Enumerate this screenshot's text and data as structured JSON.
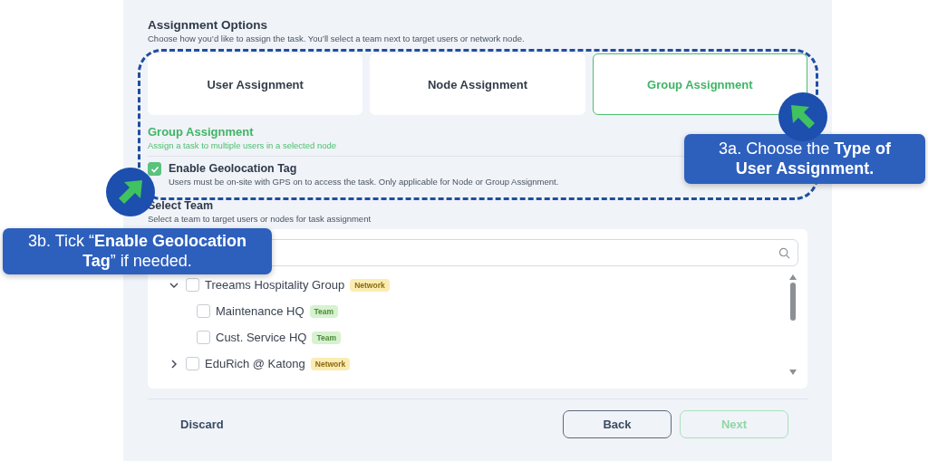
{
  "section": {
    "title": "Assignment Options",
    "subtitle": "Choose how you’d like to assign the task. You’ll select a team next to target users or network node."
  },
  "options": [
    {
      "label": "User Assignment",
      "selected": false
    },
    {
      "label": "Node Assignment",
      "selected": false
    },
    {
      "label": "Group Assignment",
      "selected": true
    }
  ],
  "selected_info": {
    "title": "Group Assignment",
    "subtitle": "Assign a task to multiple users in a selected node"
  },
  "geolocation": {
    "label": "Enable Geolocation Tag",
    "description": "Users must be on-site with GPS on to access the task. Only applicable for Node or Group Assignment.",
    "checked": true
  },
  "team": {
    "title": "Select Team",
    "subtitle": "Select a team to target users or nodes for task assignment"
  },
  "tree": [
    {
      "label": "Treeams Hospitality Group",
      "tag": {
        "text": "Network",
        "kind": "network"
      },
      "checked": false,
      "expanded": true,
      "children": [
        {
          "label": "Maintenance HQ",
          "tag": {
            "text": "Team",
            "kind": "team"
          },
          "checked": false
        },
        {
          "label": "Cust. Service HQ",
          "tag": {
            "text": "Team",
            "kind": "team"
          },
          "checked": false
        }
      ]
    },
    {
      "label": "EduRich @ Katong",
      "tag": {
        "text": "Network",
        "kind": "network"
      },
      "checked": false,
      "expanded": false
    }
  ],
  "footer": {
    "discard": "Discard",
    "back": "Back",
    "next": "Next",
    "next_disabled": true
  },
  "callouts": [
    {
      "text": "3a. Choose the **Type of User Assignment.**"
    },
    {
      "text": "3b. Tick “**Enable Geolocation Tag**” if needed."
    }
  ]
}
